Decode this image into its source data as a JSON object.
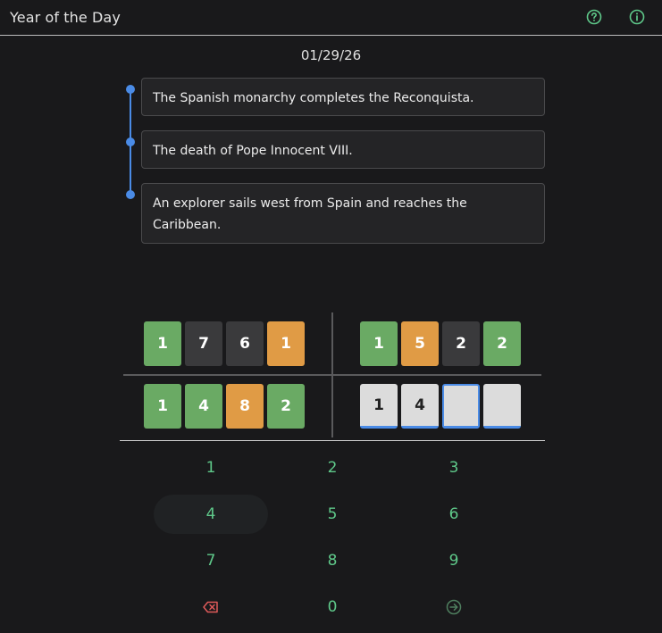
{
  "header": {
    "title": "Year of the Day",
    "help_icon": "question-circle-icon",
    "info_icon": "info-circle-icon"
  },
  "date": "01/29/26",
  "clues": [
    "The Spanish monarchy completes the Reconquista.",
    "The death of Pope Innocent VIII.",
    "An explorer sails west from Spain and reaches the Caribbean."
  ],
  "guesses": [
    {
      "digits": [
        "1",
        "7",
        "6",
        "1"
      ],
      "states": [
        "correct",
        "absent",
        "absent",
        "present"
      ]
    },
    {
      "digits": [
        "1",
        "5",
        "2",
        "2"
      ],
      "states": [
        "correct",
        "present",
        "absent",
        "correct"
      ]
    },
    {
      "digits": [
        "1",
        "4",
        "8",
        "2"
      ],
      "states": [
        "correct",
        "correct",
        "present",
        "correct"
      ]
    }
  ],
  "current_input": [
    "1",
    "4",
    "",
    ""
  ],
  "keypad": {
    "keys": [
      "1",
      "2",
      "3",
      "4",
      "5",
      "6",
      "7",
      "8",
      "9",
      "0"
    ],
    "backspace_icon": "backspace-icon",
    "submit_icon": "arrow-right-circle-icon"
  },
  "colors": {
    "correct": "#6aaa64",
    "present": "#e09b45",
    "absent": "#3a3a3c",
    "accent": "#4a8be6",
    "key_text": "#5fc98a",
    "delete": "#e05a5a"
  }
}
